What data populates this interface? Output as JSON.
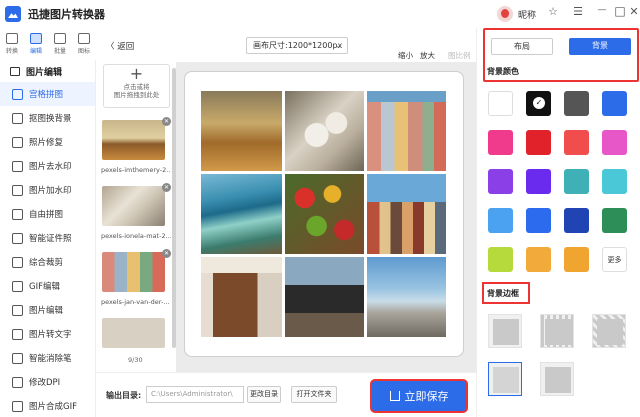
{
  "app": {
    "title": "迅捷图片转换器",
    "user_name": "昵称"
  },
  "window": {
    "pin": "☆",
    "menu": "☰",
    "minimize": "—",
    "maximize": "□",
    "close": "✕"
  },
  "rail": [
    {
      "label": "转换",
      "active": false
    },
    {
      "label": "编辑",
      "active": true
    },
    {
      "label": "批量",
      "active": false
    },
    {
      "label": "图标",
      "active": false
    }
  ],
  "menu": {
    "header": "图片编辑",
    "items": [
      {
        "label": "宫格拼图",
        "active": true
      },
      {
        "label": "抠图换背景"
      },
      {
        "label": "照片修复"
      },
      {
        "label": "图片去水印"
      },
      {
        "label": "图片加水印"
      },
      {
        "label": "自由拼图"
      },
      {
        "label": "智能证件照"
      },
      {
        "label": "综合裁剪"
      },
      {
        "label": "GIF编辑"
      },
      {
        "label": "图片编辑"
      },
      {
        "label": "图片转文字"
      },
      {
        "label": "智能消除笔"
      },
      {
        "label": "修改DPI"
      },
      {
        "label": "图片合成GIF"
      }
    ]
  },
  "toolbar": {
    "back": "〈 返回",
    "canvas_size": "画布尺寸:1200*1200px",
    "zoom_out": "缩小",
    "zoom_in": "放大",
    "fit": "图比例"
  },
  "files": {
    "add_line1": "点击或将",
    "add_line2": "图片拖拽到此处",
    "items": [
      {
        "name": "pexels-imthemery-2..."
      },
      {
        "name": "pexels-ionela-mat-2..."
      },
      {
        "name": "pexels-jan-van-der-..."
      }
    ],
    "counter": "9/30"
  },
  "bottom": {
    "output_label": "输出目录:",
    "output_path": "C:\\Users\\Administrator\\",
    "change_dir": "更改目录",
    "open_folder": "打开文件夹",
    "save": "立即保存"
  },
  "right": {
    "tab_layout": "布局",
    "tab_background": "背景",
    "bg_color_title": "背景颜色",
    "more": "更多",
    "bg_border_title": "背景边框",
    "colors": [
      "#ffffff",
      "#111111",
      "#555555",
      "#2d6ce8",
      "#f03a8c",
      "#e2222b",
      "#f24d4d",
      "#e857c8",
      "#8b3fe6",
      "#6a2bef",
      "#3fb0b5",
      "#4bc8d8",
      "#4aa2f0",
      "#2c6bed",
      "#2044b3",
      "#2d8f57",
      "#b6d93c",
      "#f2ab3b",
      "#f0a531"
    ]
  },
  "colors": {
    "accent": "#2d6ce8",
    "highlight": "#ee3333"
  }
}
